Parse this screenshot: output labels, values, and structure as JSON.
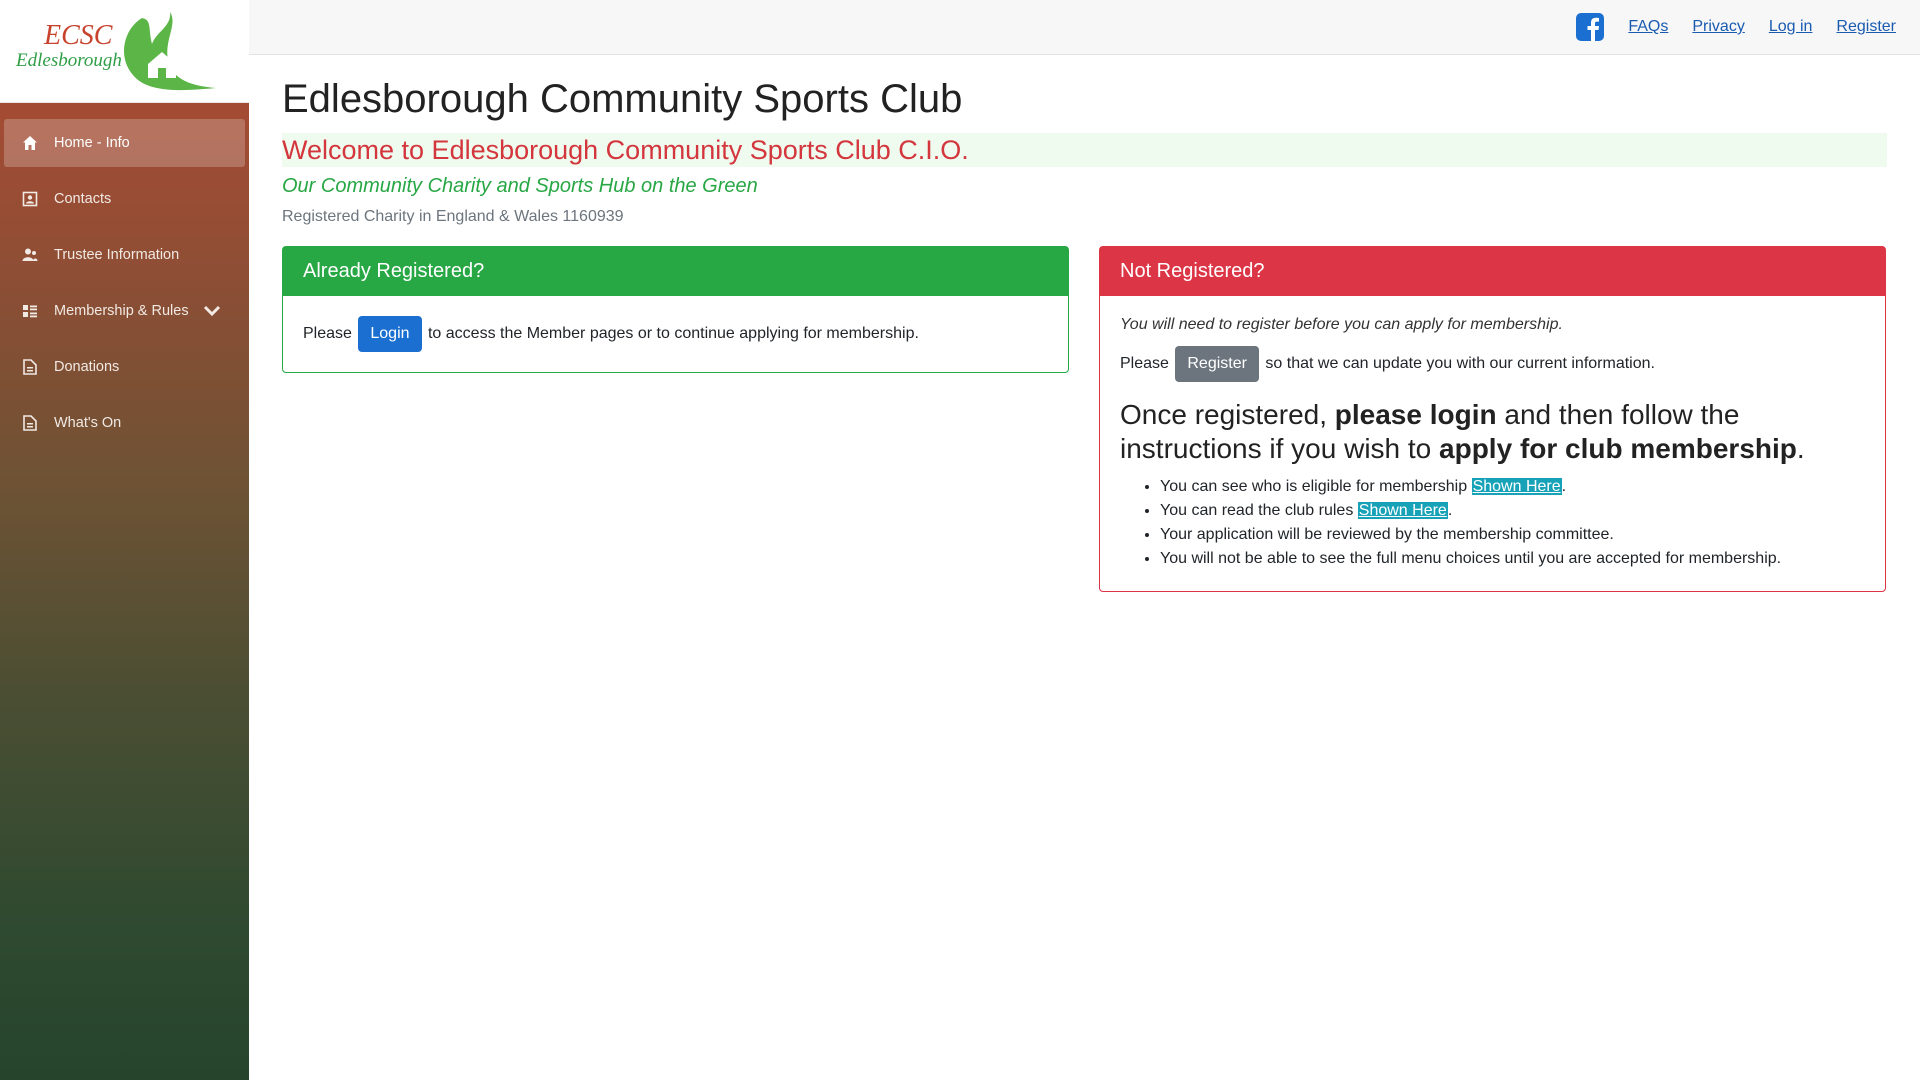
{
  "logo": {
    "line1": "ECSC",
    "line2": "Edlesborough"
  },
  "sidebar": {
    "items": [
      {
        "label": "Home - Info",
        "icon": "home-icon",
        "active": true
      },
      {
        "label": "Contacts",
        "icon": "contacts-icon"
      },
      {
        "label": "Trustee Information",
        "icon": "users-icon"
      },
      {
        "label": "Membership & Rules",
        "icon": "list-icon",
        "has_dropdown": true
      },
      {
        "label": "Donations",
        "icon": "document-icon"
      },
      {
        "label": "What's On",
        "icon": "document-icon"
      }
    ]
  },
  "topnav": {
    "links": [
      "FAQs",
      "Privacy",
      "Log in",
      "Register"
    ],
    "facebook_icon": "facebook-icon"
  },
  "main": {
    "title": "Edlesborough Community Sports Club",
    "welcome": "Welcome to Edlesborough Community Sports Club C.I.O.",
    "tagline": "Our Community Charity and Sports Hub on the Green",
    "charity": "Registered Charity in England & Wales 1160939"
  },
  "registered_card": {
    "header": "Already Registered?",
    "pre": "Please",
    "button": "Login",
    "post": "to access the Member pages or to continue applying for membership."
  },
  "not_registered_card": {
    "header": "Not Registered?",
    "note": "You will need to register before you can apply for membership.",
    "pre": "Please",
    "button": "Register",
    "post": "so that we can update you with our current information.",
    "big_1": "Once registered, ",
    "big_b1": "please login",
    "big_2": " and then follow the instructions if you wish to ",
    "big_b2": "apply for club membership",
    "big_3": ".",
    "bullets": [
      {
        "text": "You can see who is eligible for membership ",
        "link": "Shown Here",
        "after": "."
      },
      {
        "text": "You can read the club rules ",
        "link": "Shown Here",
        "after": "."
      },
      {
        "text": "Your application will be reviewed by the membership committee."
      },
      {
        "text": "You will not be able to see the full menu choices until you are accepted for membership."
      }
    ]
  },
  "colors": {
    "green": "#28a745",
    "red": "#dc3545",
    "link": "#1a5bb0",
    "highlight": "#17a2b8"
  }
}
